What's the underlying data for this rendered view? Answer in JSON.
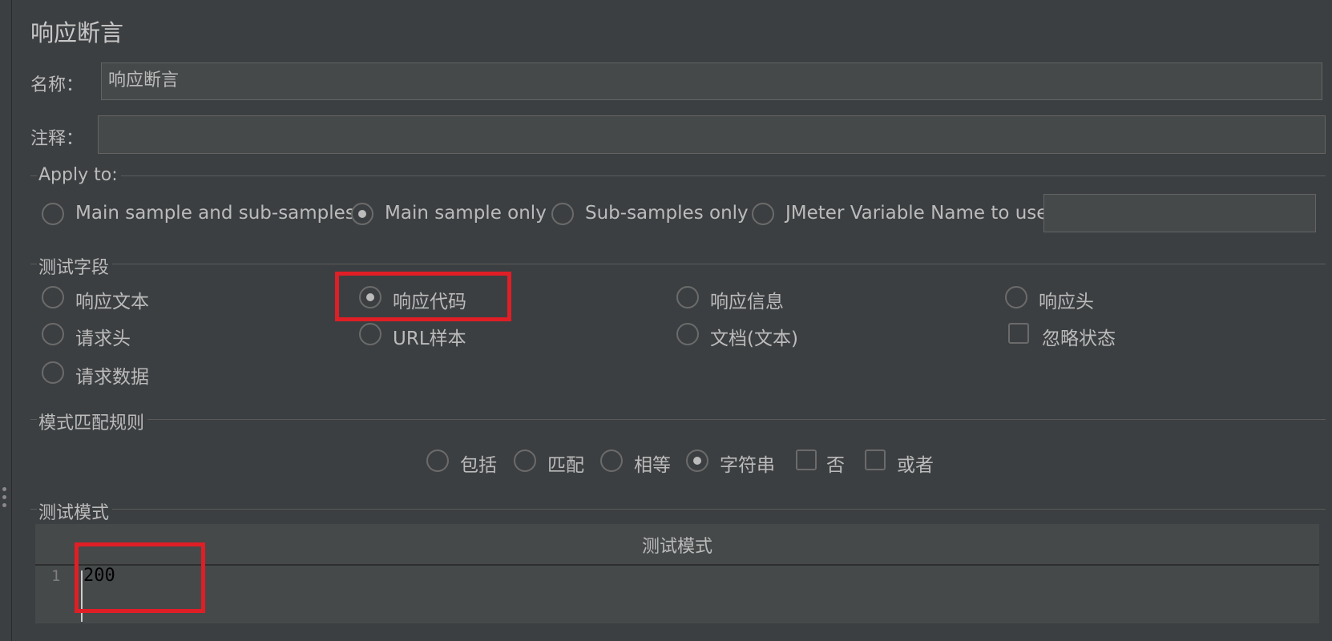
{
  "panel": {
    "title": "响应断言"
  },
  "name_row": {
    "label": "名称：",
    "value": "响应断言"
  },
  "comment_row": {
    "label": "注释：",
    "value": ""
  },
  "apply_to": {
    "title": "Apply to:",
    "options": [
      {
        "label": "Main sample and sub-samples",
        "selected": false
      },
      {
        "label": "Main sample only",
        "selected": true
      },
      {
        "label": "Sub-samples only",
        "selected": false
      },
      {
        "label": "JMeter Variable Name to use",
        "selected": false
      }
    ],
    "variable_value": ""
  },
  "test_field": {
    "title": "测试字段",
    "options": [
      {
        "label": "响应文本",
        "selected": false
      },
      {
        "label": "响应代码",
        "selected": true
      },
      {
        "label": "响应信息",
        "selected": false
      },
      {
        "label": "响应头",
        "selected": false
      },
      {
        "label": "请求头",
        "selected": false
      },
      {
        "label": "URL样本",
        "selected": false
      },
      {
        "label": "文档(文本)",
        "selected": false
      },
      {
        "label": "忽略状态",
        "checked": false
      },
      {
        "label": "请求数据",
        "selected": false
      }
    ]
  },
  "pattern_rules": {
    "title": "模式匹配规则",
    "options": [
      {
        "label": "包括",
        "selected": false
      },
      {
        "label": "匹配",
        "selected": false
      },
      {
        "label": "相等",
        "selected": false
      },
      {
        "label": "字符串",
        "selected": true
      },
      {
        "label": "否",
        "checked": false
      },
      {
        "label": "或者",
        "checked": false
      }
    ]
  },
  "test_patterns": {
    "title": "测试模式",
    "column_header": "测试模式",
    "lines": [
      {
        "number": "1",
        "text": "200"
      }
    ]
  },
  "colors": {
    "background": "#3c3f41",
    "field": "#45494a",
    "highlight": "#e01e25"
  }
}
